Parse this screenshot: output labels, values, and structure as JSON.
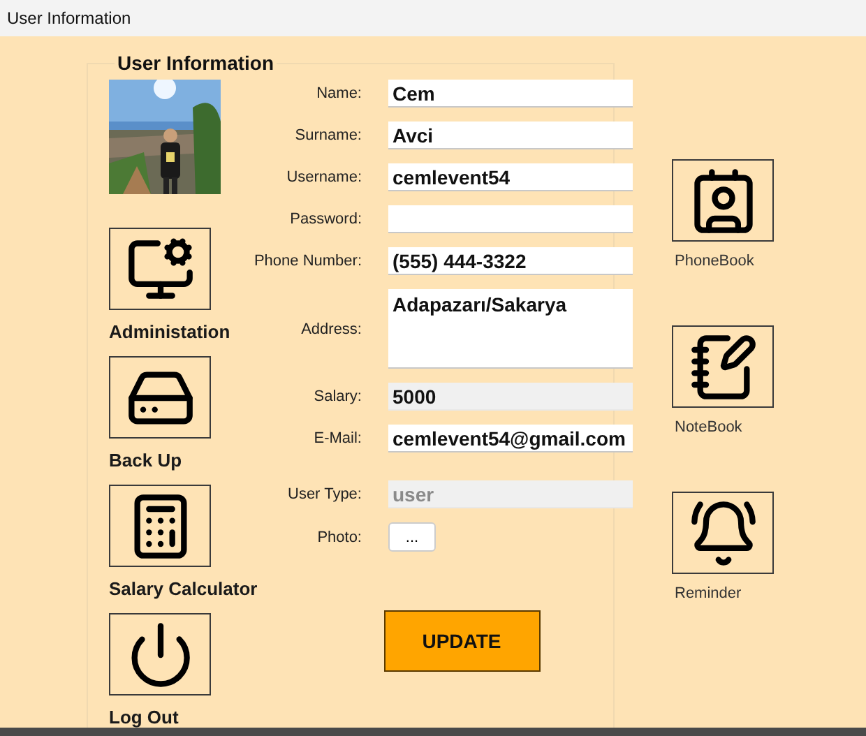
{
  "window": {
    "title": "User Information"
  },
  "group": {
    "title": "User Information"
  },
  "tools": [
    {
      "label": "Administation",
      "kind": "admin"
    },
    {
      "label": "Back Up",
      "kind": "backup"
    },
    {
      "label": "Salary Calculator",
      "kind": "salary"
    },
    {
      "label": "Log Out",
      "kind": "logout"
    }
  ],
  "fields": [
    {
      "label": "Name:",
      "kind": "text",
      "value": "Cem",
      "disabled": false
    },
    {
      "label": "Surname:",
      "kind": "text",
      "value": "Avci",
      "disabled": false
    },
    {
      "label": "Username:",
      "kind": "text",
      "value": "cemlevent54",
      "disabled": false
    },
    {
      "label": "Password:",
      "kind": "text",
      "disabled": false
    },
    {
      "label": "Phone Number:",
      "kind": "text",
      "value": "(555) 444-3322",
      "disabled": false
    },
    {
      "label": "Address:",
      "kind": "multiline",
      "value": "Adapazarı/Sakarya",
      "disabled": false
    },
    {
      "label": "Salary:",
      "kind": "text",
      "value": "5000",
      "disabled": false,
      "readonly": true
    },
    {
      "label": "E-Mail:",
      "kind": "text",
      "value": "cemlevent54@gmail.com",
      "disabled": false
    },
    {
      "label": "User Type:",
      "kind": "text",
      "value": "user",
      "disabled": true
    },
    {
      "label": "Photo:",
      "kind": "browse",
      "value": "..."
    }
  ],
  "update_button": {
    "label": "UPDATE"
  },
  "apps": [
    {
      "label": "PhoneBook",
      "kind": "phonebook"
    },
    {
      "label": "NoteBook",
      "kind": "notebook"
    },
    {
      "label": "Reminder",
      "kind": "reminder"
    }
  ]
}
